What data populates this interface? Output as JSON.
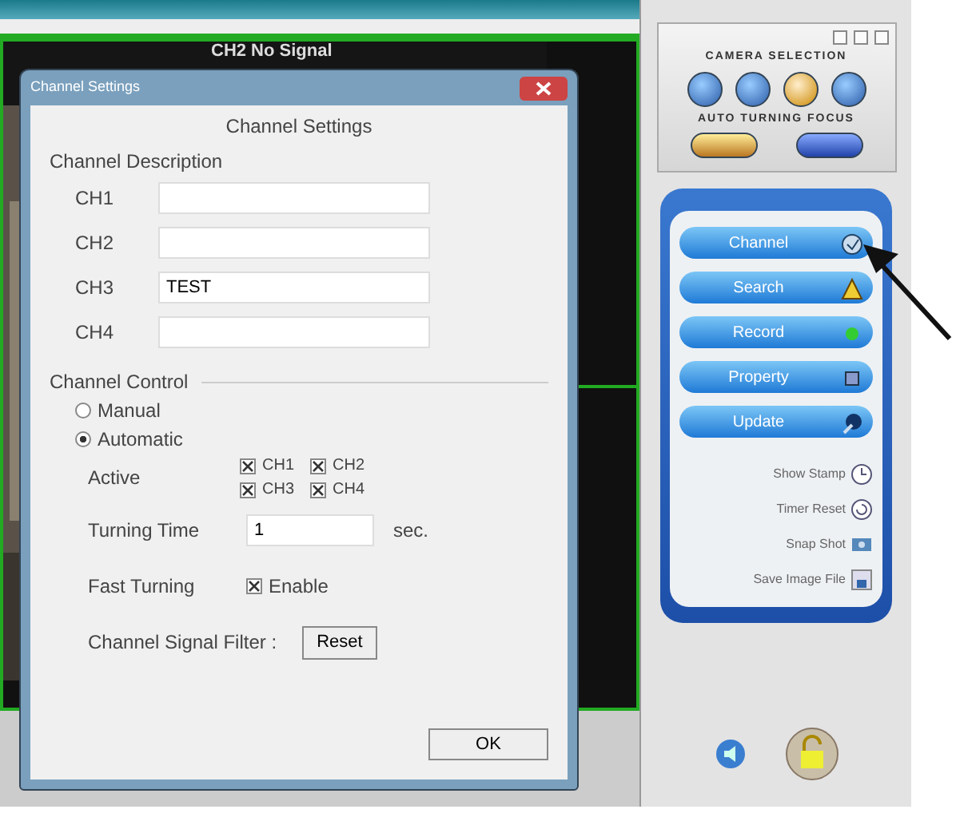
{
  "video": {
    "overlay_text": "CH2 No Signal"
  },
  "dialog": {
    "title": "Channel Settings",
    "heading": "Channel Settings",
    "description_label": "Channel Description",
    "channels": [
      {
        "label": "CH1"
      },
      {
        "label": "CH2"
      },
      {
        "label": "CH3",
        "value": "TEST"
      },
      {
        "label": "CH4"
      }
    ],
    "control_label": "Channel Control",
    "modes": [
      {
        "label": "Manual",
        "selected": false
      },
      {
        "label": "Automatic",
        "selected": true
      }
    ],
    "active_label": "Active",
    "active_channels": [
      {
        "label": "CH1",
        "checked": true
      },
      {
        "label": "CH2",
        "checked": true
      },
      {
        "label": "CH3",
        "checked": true
      },
      {
        "label": "CH4",
        "checked": true
      }
    ],
    "turning_time": {
      "label": "Turning Time",
      "value": "1",
      "unit": "sec."
    },
    "fast_turning": {
      "label": "Fast Turning",
      "option": "Enable",
      "checked": true
    },
    "signal_filter": {
      "label": "Channel Signal Filter :",
      "button": "Reset"
    },
    "ok_button": "OK"
  },
  "panel": {
    "camera_selection_label": "CAMERA SELECTION",
    "cameras": [
      {
        "selected": false
      },
      {
        "selected": false
      },
      {
        "selected": true
      },
      {
        "selected": false
      }
    ],
    "focus_label": "AUTO TURNING FOCUS",
    "focus_buttons": [
      {
        "selected": true
      },
      {
        "selected": false
      }
    ],
    "menu": [
      {
        "label": "Channel"
      },
      {
        "label": "Search"
      },
      {
        "label": "Record"
      },
      {
        "label": "Property"
      },
      {
        "label": "Update"
      }
    ],
    "tools": [
      {
        "label": "Show Stamp"
      },
      {
        "label": "Timer Reset"
      },
      {
        "label": "Snap Shot"
      },
      {
        "label": "Save Image File"
      }
    ]
  }
}
